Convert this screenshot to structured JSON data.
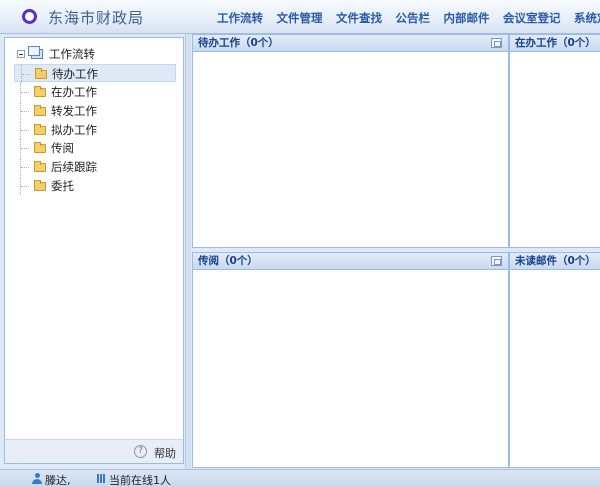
{
  "header": {
    "title": "东海市财政局",
    "nav": [
      "工作流转",
      "文件管理",
      "文件查找",
      "公告栏",
      "内部邮件",
      "会议室登记",
      "系统定制"
    ]
  },
  "sidebar": {
    "root_label": "工作流转",
    "items": [
      {
        "label": "待办工作",
        "selected": true
      },
      {
        "label": "在办工作"
      },
      {
        "label": "转发工作"
      },
      {
        "label": "拟办工作"
      },
      {
        "label": "传阅"
      },
      {
        "label": "后续跟踪"
      },
      {
        "label": "委托"
      }
    ],
    "help_label": "帮助"
  },
  "portlets": {
    "pending": "待办工作（0个）",
    "in_progress": "在办工作（0个）",
    "circulate": "传阅（0个）",
    "unread_mail": "未读邮件（0个）"
  },
  "status": {
    "user": "滕达,",
    "online": "当前在线1人"
  },
  "colors": {
    "accent": "#15428b",
    "border": "#99bbe8",
    "logo": "#5a2fc8"
  }
}
